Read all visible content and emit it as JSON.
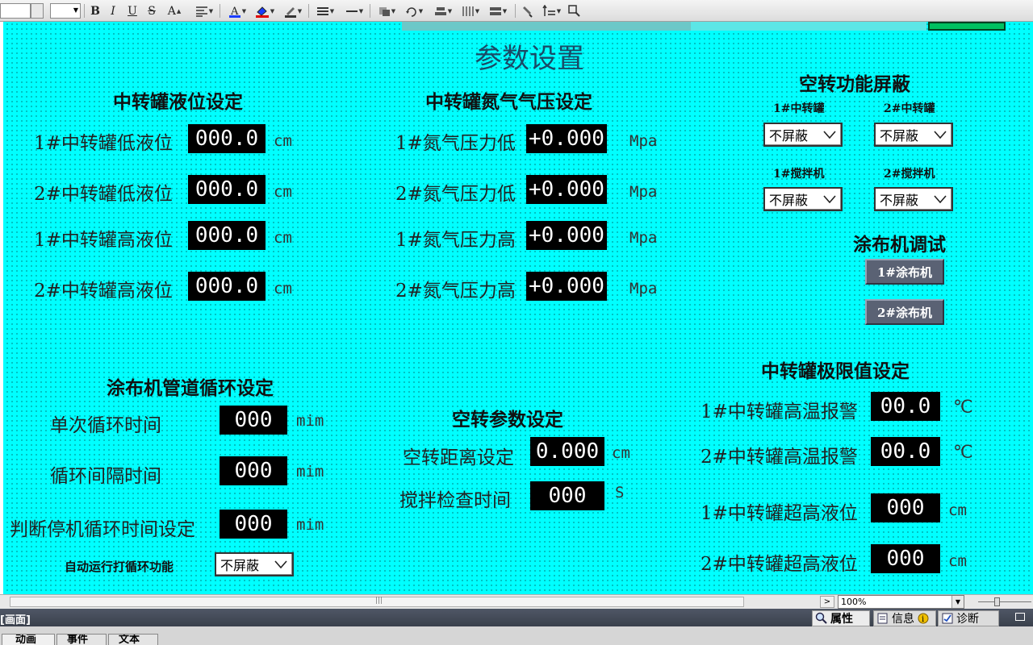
{
  "toolbar": {
    "bold": "B",
    "italic": "I",
    "underline": "U",
    "strike": "S",
    "font_size_grow": "A"
  },
  "page": {
    "title": "参数设置"
  },
  "liquid_level": {
    "heading": "中转罐液位设定",
    "rows": [
      {
        "label": "1#中转罐低液位",
        "value": "000.0",
        "unit": "cm"
      },
      {
        "label": "2#中转罐低液位",
        "value": "000.0",
        "unit": "cm"
      },
      {
        "label": "1#中转罐高液位",
        "value": "000.0",
        "unit": "cm"
      },
      {
        "label": "2#中转罐高液位",
        "value": "000.0",
        "unit": "cm"
      }
    ]
  },
  "nitrogen": {
    "heading": "中转罐氮气气压设定",
    "rows": [
      {
        "label": "1#氮气压力低",
        "value": "+0.000",
        "unit": "Mpa"
      },
      {
        "label": "2#氮气压力低",
        "value": "+0.000",
        "unit": "Mpa"
      },
      {
        "label": "1#氮气压力高",
        "value": "+0.000",
        "unit": "Mpa"
      },
      {
        "label": "2#氮气压力高",
        "value": "+0.000",
        "unit": "Mpa"
      }
    ]
  },
  "idle_mask": {
    "heading": "空转功能屏蔽",
    "items": [
      {
        "label": "1#中转罐",
        "value": "不屏蔽"
      },
      {
        "label": "2#中转罐",
        "value": "不屏蔽"
      },
      {
        "label": "1#搅拌机",
        "value": "不屏蔽"
      },
      {
        "label": "2#搅拌机",
        "value": "不屏蔽"
      }
    ]
  },
  "coater_debug": {
    "heading": "涂布机调试",
    "buttons": [
      "1#涂布机",
      "2#涂布机"
    ]
  },
  "pipe_cycle": {
    "heading": "涂布机管道循环设定",
    "rows": [
      {
        "label": "单次循环时间",
        "value": "000",
        "unit": "mim"
      },
      {
        "label": "循环间隔时间",
        "value": "000",
        "unit": "mim"
      },
      {
        "label": "判断停机循环时间设定",
        "value": "000",
        "unit": "mim"
      }
    ],
    "auto_label": "自动运行打循环功能",
    "auto_value": "不屏蔽"
  },
  "idle_params": {
    "heading": "空转参数设定",
    "rows": [
      {
        "label": "空转距离设定",
        "value": "0.000",
        "unit": "cm"
      },
      {
        "label": "搅拌检查时间",
        "value": "000",
        "unit": "S"
      }
    ]
  },
  "limit": {
    "heading": "中转罐极限值设定",
    "rows": [
      {
        "label": "1#中转罐高温报警",
        "value": "00.0",
        "unit": "℃"
      },
      {
        "label": "2#中转罐高温报警",
        "value": "00.0",
        "unit": "℃"
      },
      {
        "label": "1#中转罐超高液位",
        "value": "000",
        "unit": "cm"
      },
      {
        "label": "2#中转罐超高液位",
        "value": "000",
        "unit": "cm"
      }
    ]
  },
  "statusbar": {
    "zoom": "100%",
    "panel_title": "[画面]",
    "tabs_right": [
      "属性",
      "信息",
      "诊断"
    ],
    "tabs_bottom": [
      "动画",
      "事件",
      "文本"
    ]
  },
  "colors": {
    "canvas": "#00ffff",
    "value_bg": "#000000",
    "button_bg": "#5a6274"
  }
}
